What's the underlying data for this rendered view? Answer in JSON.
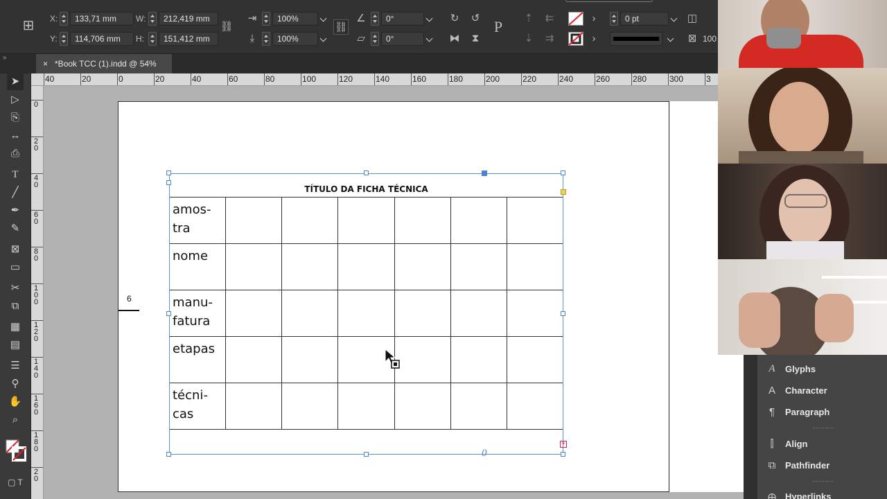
{
  "control": {
    "x_label": "X:",
    "x_value": "133,71 mm",
    "y_label": "Y:",
    "y_value": "114,706 mm",
    "w_label": "W:",
    "w_value": "212,419 mm",
    "h_label": "H:",
    "h_value": "151,412 mm",
    "scale_x": "100%",
    "scale_y": "100%",
    "rotate": "0°",
    "shear": "0°",
    "stroke_weight": "0 pt",
    "opacity_partial": "100"
  },
  "tab": {
    "title": "*Book TCC (1).indd @ 54%",
    "close": "×",
    "collapse": "»"
  },
  "ruler_h": [
    "40",
    "20",
    "0",
    "20",
    "40",
    "60",
    "80",
    "100",
    "120",
    "140",
    "160",
    "180",
    "200",
    "220",
    "240",
    "260",
    "280",
    "300",
    "3"
  ],
  "ruler_v": [
    "0",
    "2 0",
    "4 0",
    "6 0",
    "8 0",
    "1 0 0",
    "1 2 0",
    "1 4 0",
    "1 6 0",
    "1 8 0",
    "2 0"
  ],
  "page_number": "6",
  "table": {
    "title": "TÍTULO DA FICHA TÉCNICA",
    "rows": [
      "amos-\ntra",
      "nome",
      "manu-\nfatura",
      "etapas",
      "técni-\ncas"
    ]
  },
  "frame_marker": "0",
  "panels": [
    {
      "label": "Glyphs",
      "icon": "glyphs-icon"
    },
    {
      "label": "Character",
      "icon": "character-icon"
    },
    {
      "label": "Paragraph",
      "icon": "paragraph-icon"
    },
    {
      "label": "Align",
      "icon": "align-icon"
    },
    {
      "label": "Pathfinder",
      "icon": "pathfinder-icon"
    },
    {
      "label": "Hyperlinks",
      "icon": "hyperlinks-icon"
    }
  ],
  "colors": {
    "selection": "#4b84d6",
    "canvas": "#b1b1b1",
    "panel": "#454545"
  }
}
